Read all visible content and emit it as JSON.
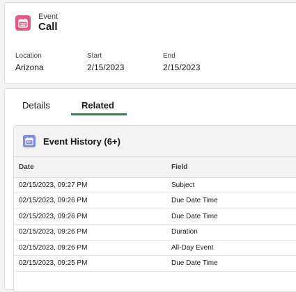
{
  "colors": {
    "event_icon_bg": "#e3587f",
    "history_icon_bg": "#7f8de1",
    "active_tab_underline": "#2e844a"
  },
  "header": {
    "icon": "calendar-icon",
    "object_type": "Event",
    "record_name": "Call",
    "fields": [
      {
        "label": "Location",
        "value": "Arizona"
      },
      {
        "label": "Start",
        "value": "2/15/2023"
      },
      {
        "label": "End",
        "value": "2/15/2023"
      }
    ]
  },
  "tabs": [
    {
      "label": "Details",
      "active": false
    },
    {
      "label": "Related",
      "active": true
    }
  ],
  "related_list": {
    "icon": "calendar-icon",
    "title": "Event History (6+)",
    "columns": [
      "Date",
      "Field"
    ],
    "rows": [
      [
        "02/15/2023, 09:27 PM",
        "Subject"
      ],
      [
        "02/15/2023, 09:26 PM",
        "Due Date Time"
      ],
      [
        "02/15/2023, 09:26 PM",
        "Due Date Time"
      ],
      [
        "02/15/2023, 09:26 PM",
        "Duration"
      ],
      [
        "02/15/2023, 09:26 PM",
        "All-Day Event"
      ],
      [
        "02/15/2023, 09:25 PM",
        "Due Date Time"
      ]
    ]
  }
}
